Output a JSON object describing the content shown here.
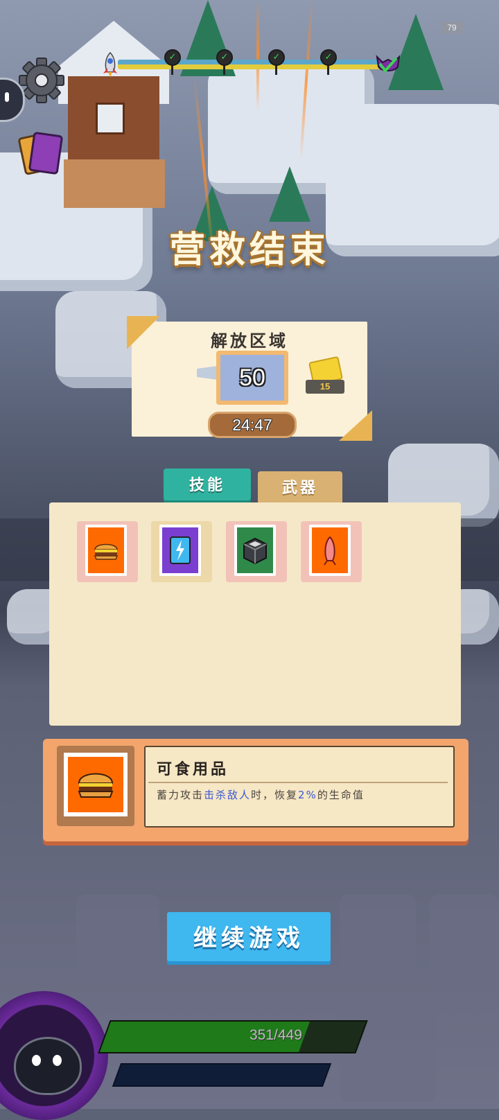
{
  "hud": {
    "fps": "79",
    "checkpoint_mark": "✓",
    "hp_text": "351/449",
    "hp_fraction": 0.78
  },
  "result": {
    "title": "营救结束",
    "stat_label": "解放区域",
    "stat_value": "50",
    "ticket_count": "15",
    "timer": "24:47"
  },
  "tabs": {
    "skills_label": "技能",
    "weapons_label": "武器"
  },
  "inventory": [
    {
      "name": "burger",
      "slot_color": "#f2c2b8",
      "fill": "#ff6a00"
    },
    {
      "name": "energy-cards",
      "slot_color": "#ecd8a8",
      "fill": "#7a3fd0"
    },
    {
      "name": "armor-box",
      "slot_color": "#f2c2b8",
      "fill": "#2f8a4a"
    },
    {
      "name": "horn",
      "slot_color": "#f2c2b8",
      "fill": "#ff6a00"
    }
  ],
  "detail": {
    "title": "可食用品",
    "text_before": "蓄力攻击",
    "text_highlight1": "击杀敌人",
    "text_middle": "时，恢复",
    "text_highlight2": "2%",
    "text_after": "的生命值"
  },
  "continue_label": "继续游戏"
}
